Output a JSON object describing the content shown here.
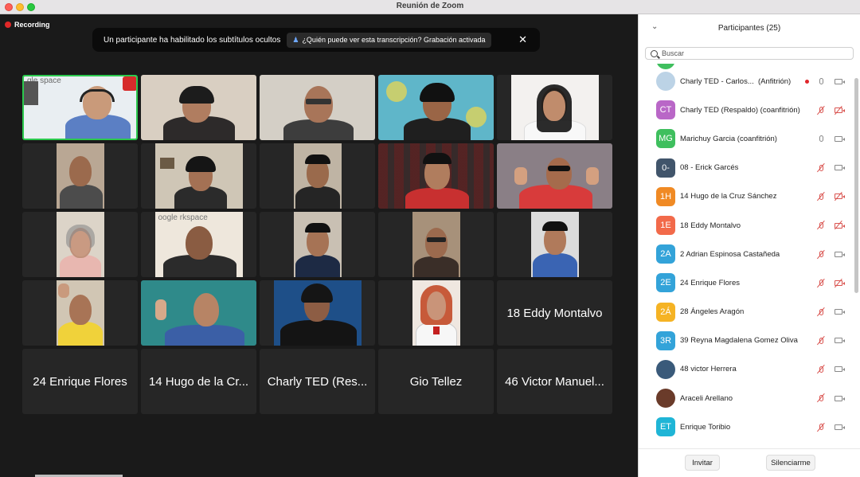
{
  "window": {
    "title": "Reunión de Zoom"
  },
  "recording": {
    "label": "Recording"
  },
  "banner": {
    "text": "Un participante ha habilitado los subtítulos ocultos",
    "chip": "¿Quién puede ver esta transcripción? Grabación activada"
  },
  "tile_name_only": {
    "t16": "18 Eddy Montalvo",
    "t21": "24 Enrique Flores",
    "t22": "14 Hugo de la Cr...",
    "t23": "Charly TED (Res...",
    "t24": "Gio Tellez",
    "t25": "46 Victor Manuel..."
  },
  "tile_text": {
    "t1": "gle space",
    "t12": "oogle rkspace"
  },
  "panel": {
    "title": "Participantes (25)",
    "search_placeholder": "Buscar",
    "invite": "Invitar",
    "mute_all": "Silenciarme"
  },
  "participants": [
    {
      "initials": "",
      "name": "Charly TED - Carlos...",
      "role": "(Anfitrión)",
      "color": "#bcd3e6",
      "photo": true
    },
    {
      "initials": "CT",
      "name": "Charly TED (Respaldo) (coanfitrión)",
      "role": "",
      "color": "#b967c7"
    },
    {
      "initials": "MG",
      "name": "Marichuy Garcia (coanfitrión)",
      "role": "",
      "color": "#3fbf5e"
    },
    {
      "initials": "0-",
      "name": "08 - Erick Garcés",
      "role": "",
      "color": "#41556b"
    },
    {
      "initials": "1H",
      "name": "14 Hugo de la Cruz Sánchez",
      "role": "",
      "color": "#f08a24"
    },
    {
      "initials": "1E",
      "name": "18 Eddy Montalvo",
      "role": "",
      "color": "#f26a4a"
    },
    {
      "initials": "2A",
      "name": "2 Adrian Espinosa Castañeda",
      "role": "",
      "color": "#33a3d9"
    },
    {
      "initials": "2E",
      "name": "24 Enrique Flores",
      "role": "",
      "color": "#33a3d9"
    },
    {
      "initials": "2Á",
      "name": "28 Ángeles Aragón",
      "role": "",
      "color": "#f5b324"
    },
    {
      "initials": "3R",
      "name": "39 Reyna Magdalena Gomez Oliva",
      "role": "",
      "color": "#33a3d9"
    },
    {
      "initials": "",
      "name": "48 victor Herrera",
      "role": "",
      "color": "#3a5a7a",
      "photo": true
    },
    {
      "initials": "",
      "name": "Araceli Arellano",
      "role": "",
      "color": "#6a3b2a",
      "photo": true
    },
    {
      "initials": "ET",
      "name": "Enrique Toribio",
      "role": "",
      "color": "#1fb5d6"
    }
  ]
}
